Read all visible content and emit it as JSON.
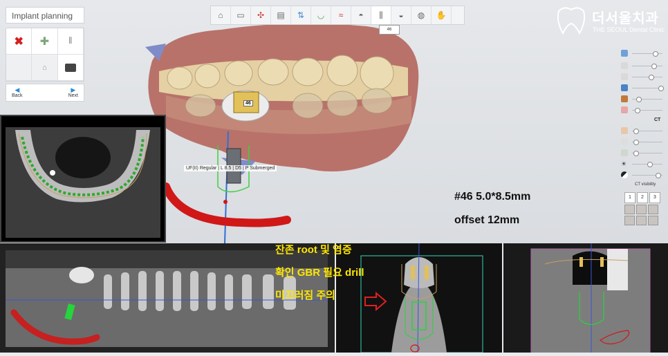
{
  "left_panel": {
    "title": "Implant planning",
    "nav_back": "Back",
    "nav_next": "Next"
  },
  "toolbar": {
    "implant_tooltip": "46"
  },
  "logo": {
    "name_kr": "더서울치과",
    "name_en": "THE SEOUL Dental Clinic"
  },
  "viewport": {
    "implant_number": "46",
    "implant_info": "UF(II) Regular | L 8.5 | D5 | P Submerged",
    "spec_size": "#46 5.0*8.5mm",
    "spec_offset": "offset 12mm"
  },
  "right_panel": {
    "ct_label": "CT",
    "ct_visibility": "CT visibility",
    "ct_views": [
      "1",
      "2",
      "3"
    ]
  },
  "notes": {
    "line1": "잔존 root 및 염증",
    "line2": "확인 GBR 필요 drill",
    "line3": "미끄러짐 주의"
  },
  "colors": {
    "nerve": "#d01818",
    "implant_gold": "#e2c15a",
    "annotation": "#ffe600",
    "accent": "#2b8ad6"
  }
}
